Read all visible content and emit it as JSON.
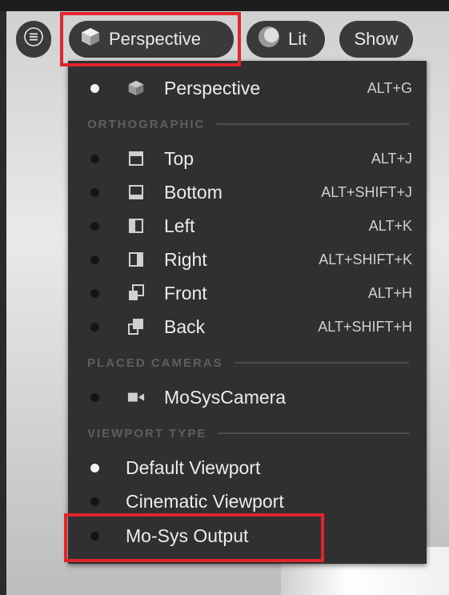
{
  "toolbar": {
    "menu_icon": "hamburger-icon",
    "perspective_label": "Perspective",
    "perspective_icon": "cube-icon",
    "lit_label": "Lit",
    "lit_icon": "sphere-icon",
    "show_label": "Show"
  },
  "dropdown": {
    "perspective": {
      "label": "Perspective",
      "shortcut": "ALT+G",
      "icon": "cube-icon",
      "selected": true
    },
    "orthographic_header": "ORTHOGRAPHIC",
    "orthographic": [
      {
        "label": "Top",
        "shortcut": "ALT+J",
        "icon": "view-top-icon"
      },
      {
        "label": "Bottom",
        "shortcut": "ALT+SHIFT+J",
        "icon": "view-bottom-icon"
      },
      {
        "label": "Left",
        "shortcut": "ALT+K",
        "icon": "view-left-icon"
      },
      {
        "label": "Right",
        "shortcut": "ALT+SHIFT+K",
        "icon": "view-right-icon"
      },
      {
        "label": "Front",
        "shortcut": "ALT+H",
        "icon": "view-front-icon"
      },
      {
        "label": "Back",
        "shortcut": "ALT+SHIFT+H",
        "icon": "view-back-icon"
      }
    ],
    "placed_cameras_header": "PLACED CAMERAS",
    "camera": {
      "label": "MoSysCamera",
      "icon": "camera-icon"
    },
    "viewport_type_header": "VIEWPORT TYPE",
    "viewport_types": [
      {
        "label": "Default Viewport",
        "selected": true
      },
      {
        "label": "Cinematic Viewport",
        "selected": false
      },
      {
        "label": "Mo-Sys Output",
        "selected": false
      }
    ]
  },
  "colors": {
    "highlight": "#e0252b",
    "menu_bg": "#303030",
    "pill_bg": "#3a3a3a"
  }
}
